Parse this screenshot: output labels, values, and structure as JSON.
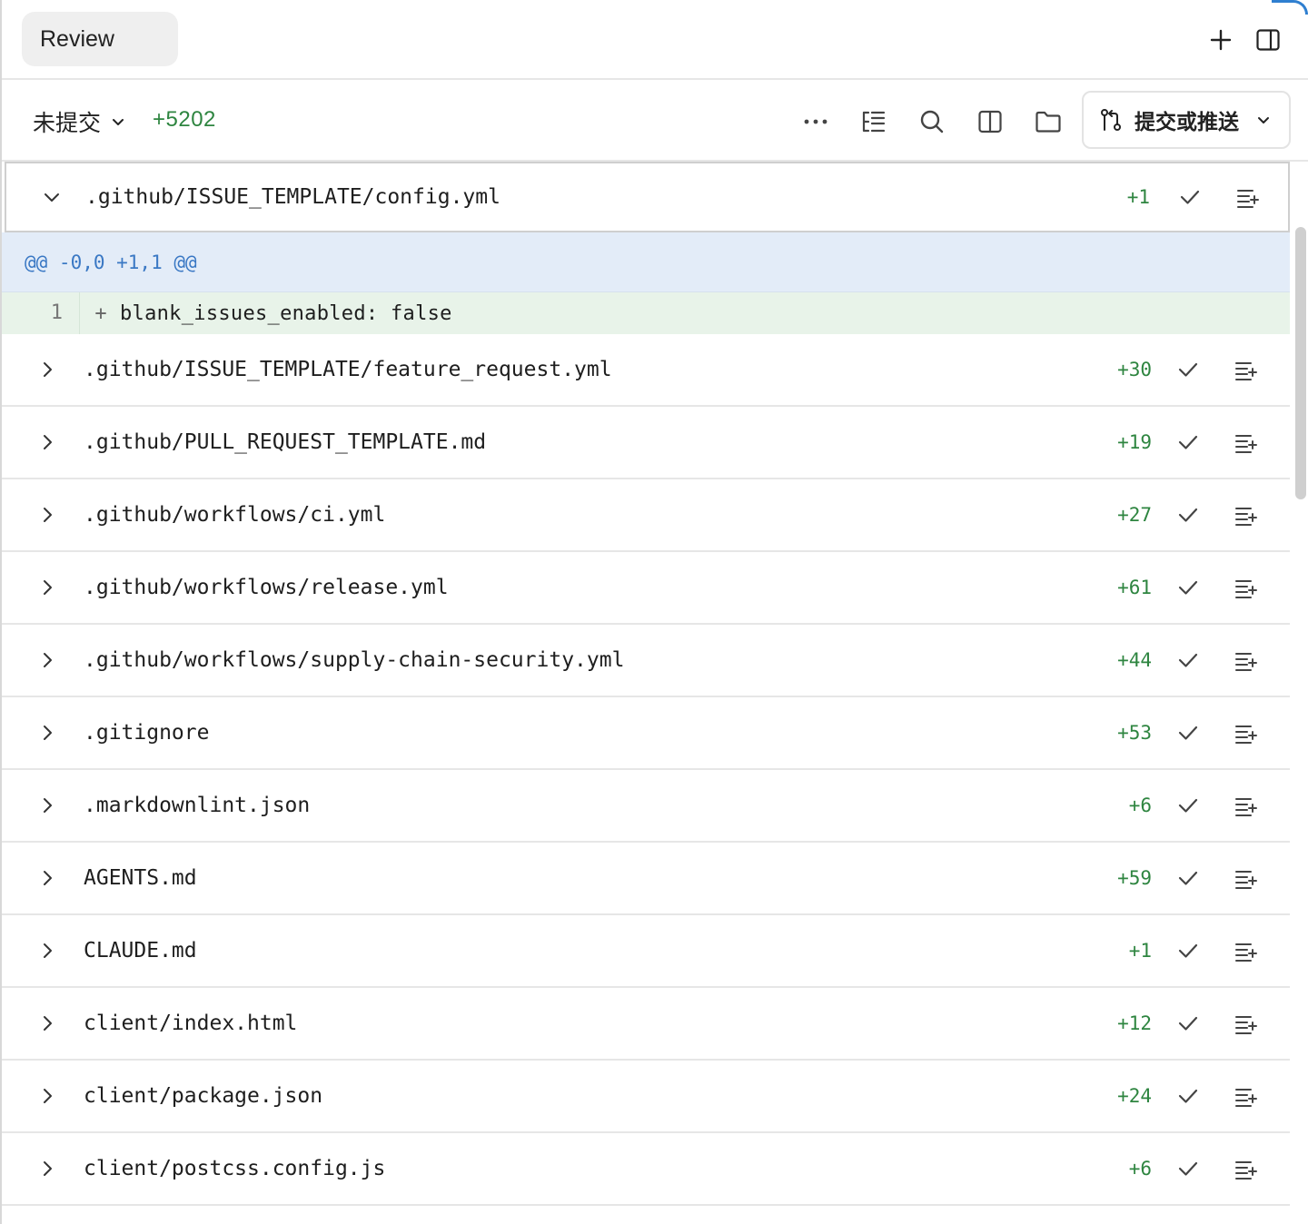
{
  "tabs": {
    "review_label": "Review"
  },
  "header_icons": {
    "new": "plus-icon",
    "panel": "sidebar-toggle-icon"
  },
  "toolbar": {
    "branch_label": "未提交",
    "added_total": "+5202",
    "more_icon": "ellipsis-icon",
    "tree_icon": "tree-list-icon",
    "search_icon": "search-icon",
    "split_icon": "split-view-icon",
    "folder_icon": "folder-icon",
    "commit_button_label": "提交或推送"
  },
  "expanded_file": {
    "path": ".github/ISSUE_TEMPLATE/config.yml",
    "added": "+1",
    "hunk_header": "@@ -0,0 +1,1 @@",
    "lines": [
      {
        "number": "1",
        "sign": "+",
        "code": "blank_issues_enabled: false"
      }
    ]
  },
  "files": [
    {
      "path": ".github/ISSUE_TEMPLATE/feature_request.yml",
      "added": "+30"
    },
    {
      "path": ".github/PULL_REQUEST_TEMPLATE.md",
      "added": "+19"
    },
    {
      "path": ".github/workflows/ci.yml",
      "added": "+27"
    },
    {
      "path": ".github/workflows/release.yml",
      "added": "+61"
    },
    {
      "path": ".github/workflows/supply-chain-security.yml",
      "added": "+44"
    },
    {
      "path": ".gitignore",
      "added": "+53"
    },
    {
      "path": ".markdownlint.json",
      "added": "+6"
    },
    {
      "path": "AGENTS.md",
      "added": "+59"
    },
    {
      "path": "CLAUDE.md",
      "added": "+1"
    },
    {
      "path": "client/index.html",
      "added": "+12"
    },
    {
      "path": "client/package.json",
      "added": "+24"
    },
    {
      "path": "client/postcss.config.js",
      "added": "+6"
    }
  ],
  "colors": {
    "added": "#2e8540",
    "hunk_bg": "#e3ecf8",
    "hunk_text": "#3a78c4",
    "added_line_bg": "#e8f3e9",
    "accent": "#2f7fd0"
  }
}
